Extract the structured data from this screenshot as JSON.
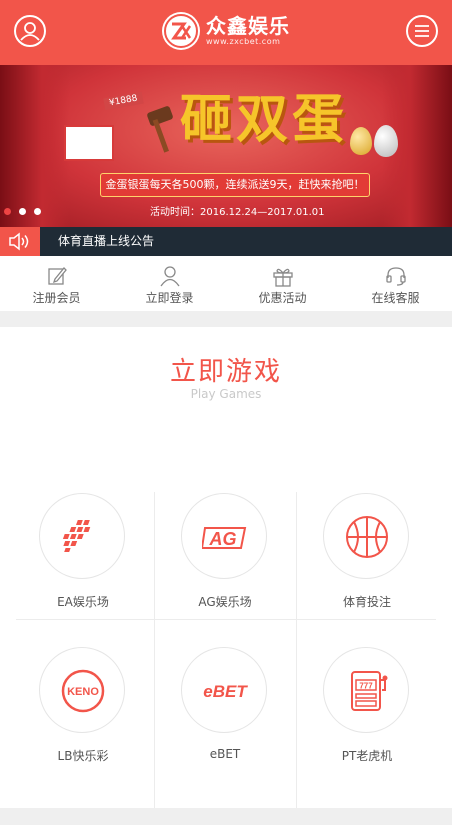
{
  "header": {
    "brand_name": "众鑫娱乐",
    "brand_url": "www.zxcbet.com"
  },
  "banner": {
    "headline": "砸双蛋",
    "price_tag": "¥1888",
    "ribbon_text": "金蛋银蛋每天各500颗，连续派送9天，赶快来抢吧！",
    "event_date": "活动时间：2016.12.24—2017.01.01",
    "slide_count": 3,
    "active_slide": 1
  },
  "notice": {
    "text": "体育直播上线公告"
  },
  "quick_nav": [
    {
      "label": "注册会员",
      "icon": "pencil-icon"
    },
    {
      "label": "立即登录",
      "icon": "user-icon"
    },
    {
      "label": "优惠活动",
      "icon": "gift-icon"
    },
    {
      "label": "在线客服",
      "icon": "headset-icon"
    }
  ],
  "games_section": {
    "title": "立即游戏",
    "subtitle": "Play Games",
    "items": [
      {
        "label": "EA娱乐场",
        "icon": "ea-logo-icon"
      },
      {
        "label": "AG娱乐场",
        "icon": "ag-logo-icon"
      },
      {
        "label": "体育投注",
        "icon": "basketball-icon"
      },
      {
        "label": "LB快乐彩",
        "icon": "keno-logo-icon"
      },
      {
        "label": "eBET",
        "icon": "ebet-logo-icon"
      },
      {
        "label": "PT老虎机",
        "icon": "slot-machine-icon"
      }
    ]
  },
  "colors": {
    "accent": "#f2554a",
    "notice_bg": "#1f2b36"
  }
}
